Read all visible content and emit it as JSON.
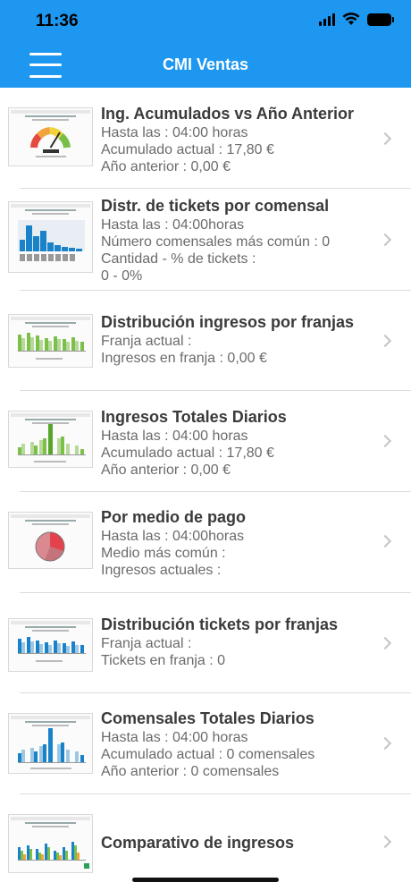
{
  "status": {
    "time": "11:36"
  },
  "header": {
    "title": "CMI Ventas",
    "menu_icon": "hamburger-icon"
  },
  "items": [
    {
      "title": "Ing. Acumulados vs Año Anterior",
      "lines": [
        "Hasta las  : 04:00 horas",
        "Acumulado actual : 17,80 €",
        "Año anterior : 0,00 €"
      ],
      "thumb": "gauge-chart-thumbnail"
    },
    {
      "title": "Distr. de tickets por comensal",
      "lines": [
        "Hasta las  : 04:00horas",
        "Número comensales más común : 0",
        "Cantidad - % de tickets :",
        "0 - 0%"
      ],
      "thumb": "bar-chart-thumbnail"
    },
    {
      "title": "Distribución ingresos por franjas",
      "lines": [
        "Franja actual :",
        "Ingresos en franja : 0,00 €"
      ],
      "thumb": "green-bar-chart-thumbnail"
    },
    {
      "title": "Ingresos Totales Diarios",
      "lines": [
        "Hasta las  : 04:00 horas",
        "Acumulado actual : 17,80 €",
        "Año anterior : 0,00 €"
      ],
      "thumb": "green-bar-chart-thumbnail"
    },
    {
      "title": "Por medio de pago",
      "lines": [
        "Hasta las  : 04:00horas",
        "Medio más común :",
        "Ingresos actuales :"
      ],
      "thumb": "pie-chart-thumbnail"
    },
    {
      "title": "Distribución tickets por franjas",
      "lines": [
        "Franja actual :",
        "Tickets en franja : 0"
      ],
      "thumb": "blue-bar-chart-thumbnail"
    },
    {
      "title": "Comensales Totales Diarios",
      "lines": [
        "Hasta las  : 04:00 horas",
        "Acumulado actual : 0 comensales",
        "Año anterior : 0 comensales"
      ],
      "thumb": "blue-bar-chart-thumbnail"
    },
    {
      "title": "Comparativo de ingresos",
      "lines": [],
      "thumb": "comparison-bar-chart-thumbnail"
    }
  ],
  "colors": {
    "header": "#1e97f0",
    "bar_green": "#7cc04a",
    "bar_blue": "#1a82c8",
    "pie_red": "#e4424d",
    "gauge_needle": "#2b2b2b"
  }
}
